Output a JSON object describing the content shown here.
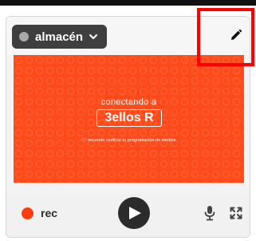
{
  "source_select": {
    "label": "almacén",
    "status_color": "#a9a9a9"
  },
  "header": {
    "edit_icon": "pencil-icon"
  },
  "video": {
    "background_color": "#ff4a1a",
    "connecting_text": "conectando a",
    "logo_text": "3ellos R",
    "notice_text": "ⓘ recuerde verificar tu programación de medios"
  },
  "controls": {
    "rec_label": "rec",
    "rec_color": "#ff3b10",
    "play_icon": "play-icon",
    "mic_icon": "microphone-icon",
    "expand_icon": "expand-icon"
  },
  "highlight": {
    "color": "#ff0000"
  }
}
